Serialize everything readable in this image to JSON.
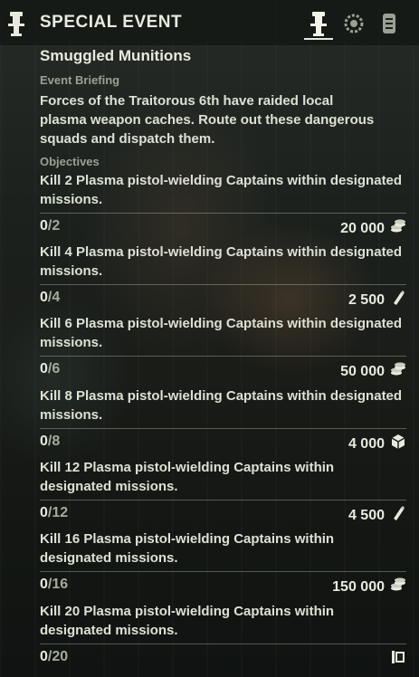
{
  "header": {
    "title": "SPECIAL EVENT",
    "icon": "event-totem-icon",
    "tabs": [
      {
        "name": "event-totem-icon",
        "active": true
      },
      {
        "name": "laurel-wreath-icon",
        "active": false
      },
      {
        "name": "reliquary-icon",
        "active": false
      }
    ]
  },
  "event": {
    "name": "Smuggled Munitions",
    "briefing_label": "Event Briefing",
    "briefing": "Forces of the Traitorous 6th have raided local plasma weapon caches. Route out these dangerous squads and dispatch them.",
    "objectives_label": "Objectives"
  },
  "objectives": [
    {
      "text": "Kill 2 Plasma pistol-wielding Captains within designated missions.",
      "current": "0",
      "total": "/2",
      "reward": "20 000",
      "reward_icon": "coins-icon"
    },
    {
      "text": "Kill 4 Plasma pistol-wielding Captains within designated missions.",
      "current": "0",
      "total": "/4",
      "reward": "2 500",
      "reward_icon": "ammo-shell-icon"
    },
    {
      "text": "Kill 6 Plasma pistol-wielding Captains within designated missions.",
      "current": "0",
      "total": "/6",
      "reward": "50 000",
      "reward_icon": "coins-icon"
    },
    {
      "text": "Kill 8 Plasma pistol-wielding Captains within designated missions.",
      "current": "0",
      "total": "/8",
      "reward": "4 000",
      "reward_icon": "cube-icon"
    },
    {
      "text": "Kill 12 Plasma pistol-wielding Captains within designated missions.",
      "current": "0",
      "total": "/12",
      "reward": "4 500",
      "reward_icon": "ammo-shell-icon"
    },
    {
      "text": "Kill 16 Plasma pistol-wielding Captains within designated missions.",
      "current": "0",
      "total": "/16",
      "reward": "150 000",
      "reward_icon": "coins-icon"
    },
    {
      "text": "Kill 20 Plasma pistol-wielding Captains within designated missions.",
      "current": "0",
      "total": "/20",
      "reward": "",
      "reward_icon": "banner-icon"
    }
  ],
  "colors": {
    "text": "#dde0d3",
    "muted": "#9aa192",
    "rule": "#d2d7c8"
  }
}
